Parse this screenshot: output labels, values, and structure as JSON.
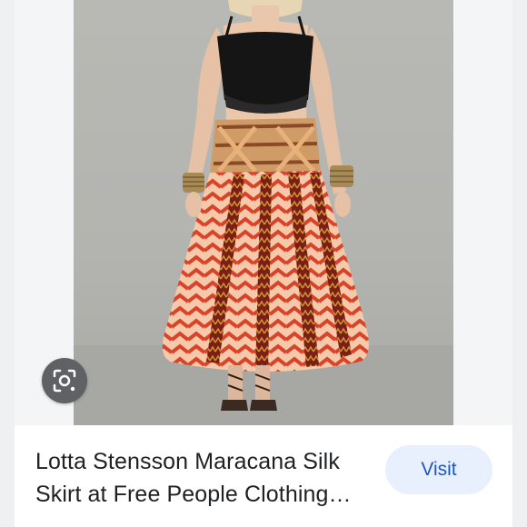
{
  "result": {
    "title": "Lotta Stensson Maracana Silk Skirt at Free People Clothing Boutique",
    "visit_label": "Visit",
    "subline": ""
  },
  "image": {
    "icon": "lens-camera-icon",
    "accent_colors": {
      "top": "#151515",
      "skirt_orange": "#d9452a",
      "skirt_cream": "#f3c7a6",
      "waistband": "#cf9c68",
      "backdrop": "#b5b5b2"
    }
  },
  "colors": {
    "visit_bg": "#e8f0fe",
    "visit_text": "#1a57c6",
    "title_text": "#202124"
  }
}
